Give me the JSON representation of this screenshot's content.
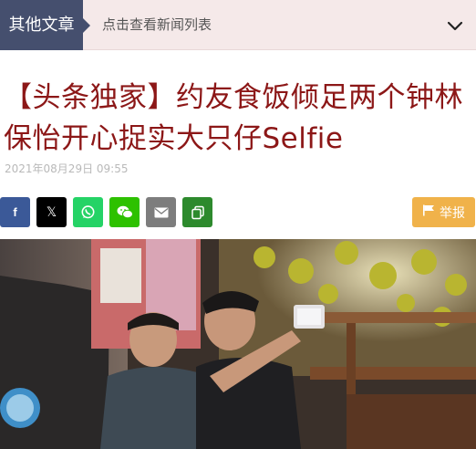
{
  "topbar": {
    "category_label": "其他文章",
    "list_link": "点击查看新闻列表",
    "dropdown_icon": "chevron-down-icon"
  },
  "article": {
    "title": "【头条独家】约友食饭倾足两个钟林保怡开心捉实大只仔Selfie",
    "date": "2021年08月29日 09:55"
  },
  "share": {
    "buttons": [
      {
        "icon": "facebook-icon",
        "glyph": "f"
      },
      {
        "icon": "x-icon",
        "glyph": "𝕏"
      },
      {
        "icon": "whatsapp-icon"
      },
      {
        "icon": "wechat-icon"
      },
      {
        "icon": "mail-icon"
      },
      {
        "icon": "copy-icon"
      }
    ],
    "report_label": "举报"
  },
  "colors": {
    "title": "#8c1717",
    "category_bg": "#454f6e",
    "topbar_bg": "#f5e9e9",
    "report_bg": "#f0b24a"
  }
}
